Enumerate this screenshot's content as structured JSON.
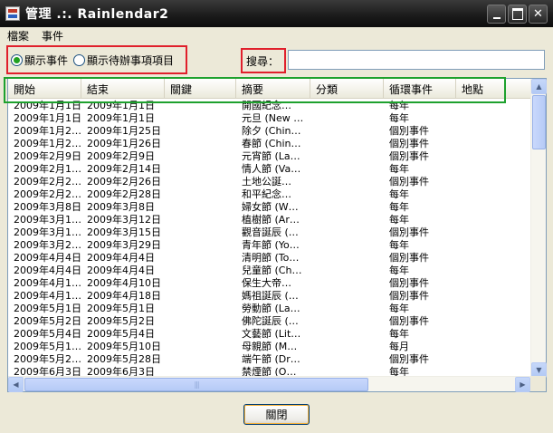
{
  "window": {
    "title": "管理 .:. Rainlendar2",
    "close_glyph": "✕"
  },
  "menu": {
    "items": [
      "檔案",
      "事件"
    ]
  },
  "filter": {
    "show_events_label": "顯示事件",
    "show_todo_label": "顯示待辦事項項目",
    "selected": "show_events"
  },
  "search": {
    "label": "搜尋：",
    "value": ""
  },
  "table": {
    "columns": [
      "開始",
      "結束",
      "關鍵",
      "摘要",
      "分類",
      "循環事件",
      "地點"
    ],
    "rows": [
      [
        "2009年1月1日",
        "2009年1月1日",
        "",
        "開國紀念…",
        "",
        "每年",
        ""
      ],
      [
        "2009年1月1日",
        "2009年1月1日",
        "",
        "元旦 (New …",
        "",
        "每年",
        ""
      ],
      [
        "2009年1月2…",
        "2009年1月25日",
        "",
        "除夕 (Chin…",
        "",
        "個別事件",
        ""
      ],
      [
        "2009年1月2…",
        "2009年1月26日",
        "",
        "春節 (Chin…",
        "",
        "個別事件",
        ""
      ],
      [
        "2009年2月9日",
        "2009年2月9日",
        "",
        "元宵節 (La…",
        "",
        "個別事件",
        ""
      ],
      [
        "2009年2月1…",
        "2009年2月14日",
        "",
        "情人節 (Va…",
        "",
        "每年",
        ""
      ],
      [
        "2009年2月2…",
        "2009年2月26日",
        "",
        "土地公誕…",
        "",
        "個別事件",
        ""
      ],
      [
        "2009年2月2…",
        "2009年2月28日",
        "",
        "和平紀念…",
        "",
        "每年",
        ""
      ],
      [
        "2009年3月8日",
        "2009年3月8日",
        "",
        "婦女節 (W…",
        "",
        "每年",
        ""
      ],
      [
        "2009年3月1…",
        "2009年3月12日",
        "",
        "植樹節 (Ar…",
        "",
        "每年",
        ""
      ],
      [
        "2009年3月1…",
        "2009年3月15日",
        "",
        "觀音誕辰 (…",
        "",
        "個別事件",
        ""
      ],
      [
        "2009年3月2…",
        "2009年3月29日",
        "",
        "青年節 (Yo…",
        "",
        "每年",
        ""
      ],
      [
        "2009年4月4日",
        "2009年4月4日",
        "",
        "清明節 (To…",
        "",
        "個別事件",
        ""
      ],
      [
        "2009年4月4日",
        "2009年4月4日",
        "",
        "兒童節 (Ch…",
        "",
        "每年",
        ""
      ],
      [
        "2009年4月1…",
        "2009年4月10日",
        "",
        "保生大帝…",
        "",
        "個別事件",
        ""
      ],
      [
        "2009年4月1…",
        "2009年4月18日",
        "",
        "媽祖誕辰 (…",
        "",
        "個別事件",
        ""
      ],
      [
        "2009年5月1日",
        "2009年5月1日",
        "",
        "勞動節 (La…",
        "",
        "每年",
        ""
      ],
      [
        "2009年5月2日",
        "2009年5月2日",
        "",
        "佛陀誕辰 (…",
        "",
        "個別事件",
        ""
      ],
      [
        "2009年5月4日",
        "2009年5月4日",
        "",
        "文藝節 (Lit…",
        "",
        "每年",
        ""
      ],
      [
        "2009年5月1…",
        "2009年5月10日",
        "",
        "母親節 (M…",
        "",
        "每月",
        ""
      ],
      [
        "2009年5月2…",
        "2009年5月28日",
        "",
        "端午節 (Dr…",
        "",
        "個別事件",
        ""
      ],
      [
        "2009年6月3日",
        "2009年6月3日",
        "",
        "禁煙節 (O…",
        "",
        "每年",
        ""
      ]
    ]
  },
  "buttons": {
    "close_label": "關閉"
  },
  "colors": {
    "highlight_red": "#e0202c",
    "highlight_green": "#1ea12e"
  }
}
